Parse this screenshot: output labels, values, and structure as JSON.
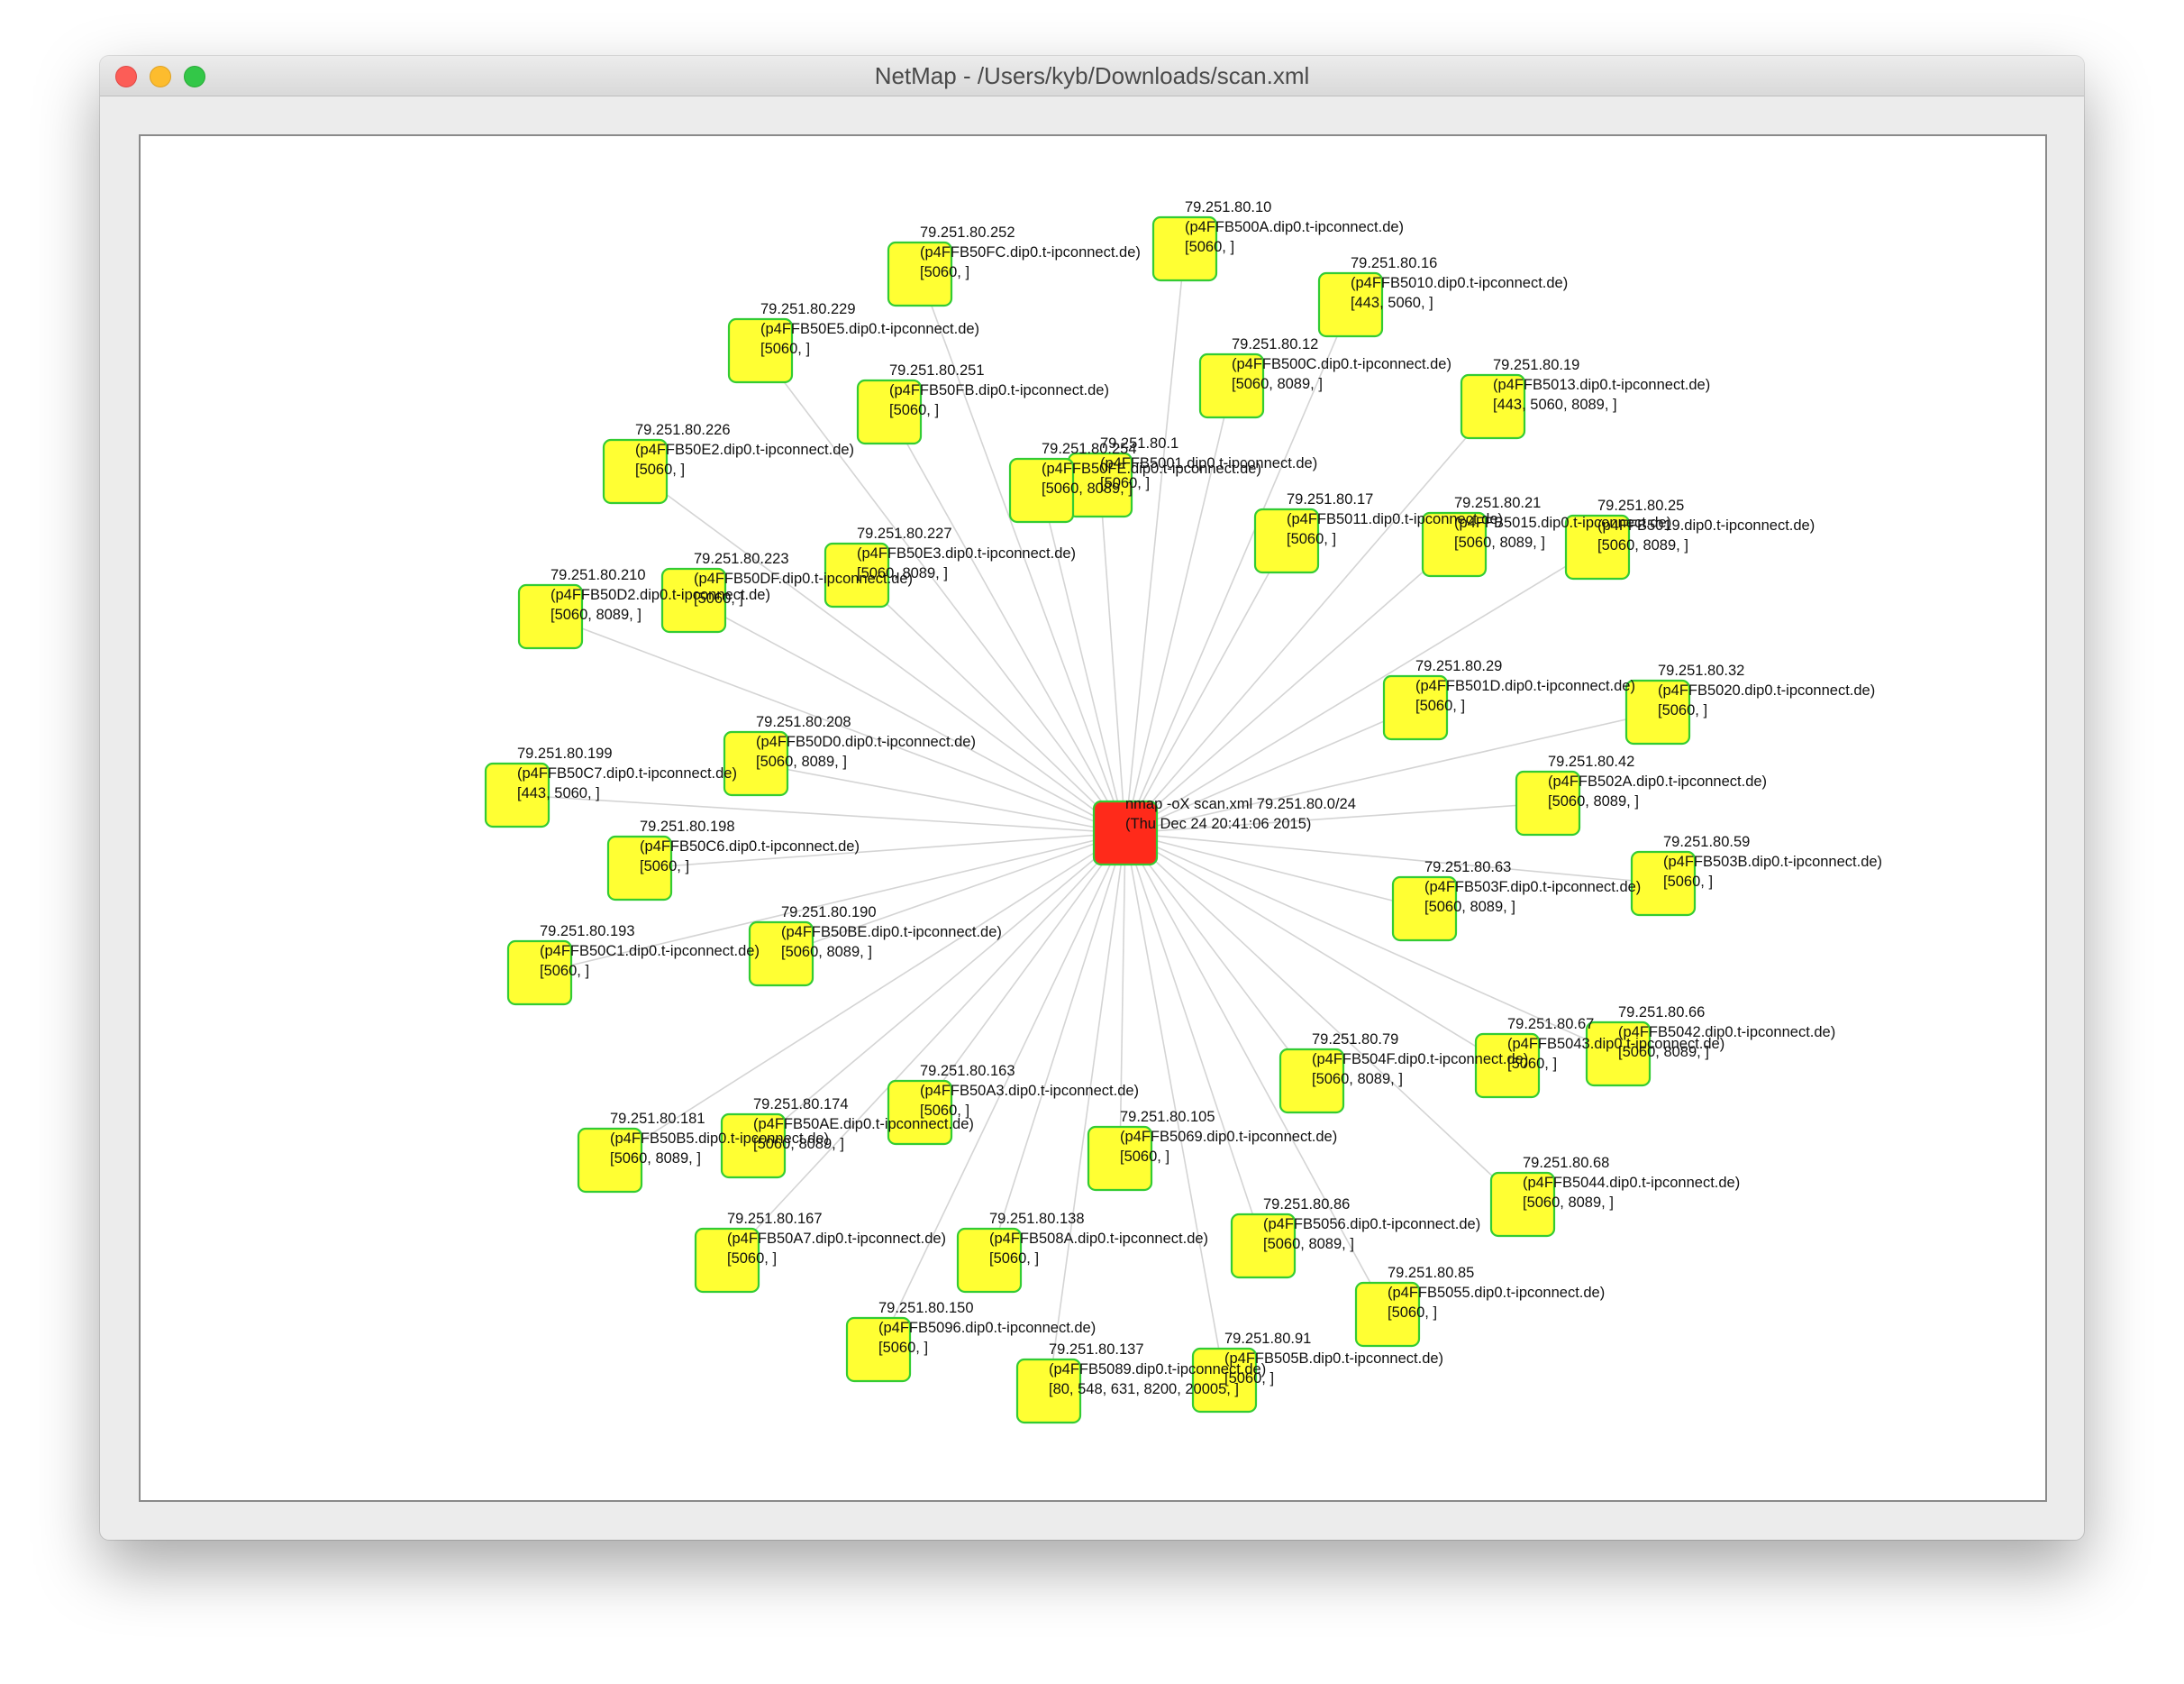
{
  "window": {
    "title": "NetMap - /Users/kyb/Downloads/scan.xml"
  },
  "colors": {
    "root_fill": "#ff2a1a",
    "host_fill": "#ffff33",
    "node_border": "#33cc33",
    "edge": "#d4d4d4"
  },
  "root": {
    "line1": "nmap -oX scan.xml 79.251.80.0/24",
    "line2": "(Thu Dec 24 20:41:06 2015)"
  },
  "hosts": [
    {
      "ip": "79.251.80.10",
      "host": "(p4FFB500A.dip0.t-ipconnect.de)",
      "ports": "[5060, ]"
    },
    {
      "ip": "79.251.80.252",
      "host": "(p4FFB50FC.dip0.t-ipconnect.de)",
      "ports": "[5060, ]"
    },
    {
      "ip": "79.251.80.16",
      "host": "(p4FFB5010.dip0.t-ipconnect.de)",
      "ports": "[443, 5060, ]"
    },
    {
      "ip": "79.251.80.229",
      "host": "(p4FFB50E5.dip0.t-ipconnect.de)",
      "ports": "[5060, ]"
    },
    {
      "ip": "79.251.80.12",
      "host": "(p4FFB500C.dip0.t-ipconnect.de)",
      "ports": "[5060, 8089, ]"
    },
    {
      "ip": "79.251.80.251",
      "host": "(p4FFB50FB.dip0.t-ipconnect.de)",
      "ports": "[5060, ]"
    },
    {
      "ip": "79.251.80.19",
      "host": "(p4FFB5013.dip0.t-ipconnect.de)",
      "ports": "[443, 5060, 8089, ]"
    },
    {
      "ip": "79.251.80.226",
      "host": "(p4FFB50E2.dip0.t-ipconnect.de)",
      "ports": "[5060, ]"
    },
    {
      "ip": "79.251.80.1",
      "host": "(p4FFB5001.dip0.t-ipconnect.de)",
      "ports": "[5060, ]"
    },
    {
      "ip": "79.251.80.254",
      "host": "(p4FFB50FE.dip0.t-ipconnect.de)",
      "ports": "[5060, 8089, ]"
    },
    {
      "ip": "79.251.80.17",
      "host": "(p4FFB5011.dip0.t-ipconnect.de)",
      "ports": "[5060, ]"
    },
    {
      "ip": "79.251.80.21",
      "host": "(p4FFB5015.dip0.t-ipconnect.de)",
      "ports": "[5060, 8089, ]"
    },
    {
      "ip": "79.251.80.25",
      "host": "(p4FFB5019.dip0.t-ipconnect.de)",
      "ports": "[5060, 8089, ]"
    },
    {
      "ip": "79.251.80.227",
      "host": "(p4FFB50E3.dip0.t-ipconnect.de)",
      "ports": "[5060, 8089, ]"
    },
    {
      "ip": "79.251.80.223",
      "host": "(p4FFB50DF.dip0.t-ipconnect.de)",
      "ports": "[5060, ]"
    },
    {
      "ip": "79.251.80.210",
      "host": "(p4FFB50D2.dip0.t-ipconnect.de)",
      "ports": "[5060, 8089, ]"
    },
    {
      "ip": "79.251.80.29",
      "host": "(p4FFB501D.dip0.t-ipconnect.de)",
      "ports": "[5060, ]"
    },
    {
      "ip": "79.251.80.32",
      "host": "(p4FFB5020.dip0.t-ipconnect.de)",
      "ports": "[5060, ]"
    },
    {
      "ip": "79.251.80.208",
      "host": "(p4FFB50D0.dip0.t-ipconnect.de)",
      "ports": "[5060, 8089, ]"
    },
    {
      "ip": "79.251.80.42",
      "host": "(p4FFB502A.dip0.t-ipconnect.de)",
      "ports": "[5060, 8089, ]"
    },
    {
      "ip": "79.251.80.199",
      "host": "(p4FFB50C7.dip0.t-ipconnect.de)",
      "ports": "[443, 5060, ]"
    },
    {
      "ip": "79.251.80.198",
      "host": "(p4FFB50C6.dip0.t-ipconnect.de)",
      "ports": "[5060, ]"
    },
    {
      "ip": "79.251.80.59",
      "host": "(p4FFB503B.dip0.t-ipconnect.de)",
      "ports": "[5060, ]"
    },
    {
      "ip": "79.251.80.63",
      "host": "(p4FFB503F.dip0.t-ipconnect.de)",
      "ports": "[5060, 8089, ]"
    },
    {
      "ip": "79.251.80.190",
      "host": "(p4FFB50BE.dip0.t-ipconnect.de)",
      "ports": "[5060, 8089, ]"
    },
    {
      "ip": "79.251.80.193",
      "host": "(p4FFB50C1.dip0.t-ipconnect.de)",
      "ports": "[5060, ]"
    },
    {
      "ip": "79.251.80.66",
      "host": "(p4FFB5042.dip0.t-ipconnect.de)",
      "ports": "[5060, 8089, ]"
    },
    {
      "ip": "79.251.80.67",
      "host": "(p4FFB5043.dip0.t-ipconnect.de)",
      "ports": "[5060, ]"
    },
    {
      "ip": "79.251.80.79",
      "host": "(p4FFB504F.dip0.t-ipconnect.de)",
      "ports": "[5060, 8089, ]"
    },
    {
      "ip": "79.251.80.163",
      "host": "(p4FFB50A3.dip0.t-ipconnect.de)",
      "ports": "[5060, ]"
    },
    {
      "ip": "79.251.80.174",
      "host": "(p4FFB50AE.dip0.t-ipconnect.de)",
      "ports": "[5060, 8089, ]"
    },
    {
      "ip": "79.251.80.181",
      "host": "(p4FFB50B5.dip0.t-ipconnect.de)",
      "ports": "[5060, 8089, ]"
    },
    {
      "ip": "79.251.80.105",
      "host": "(p4FFB5069.dip0.t-ipconnect.de)",
      "ports": "[5060, ]"
    },
    {
      "ip": "79.251.80.68",
      "host": "(p4FFB5044.dip0.t-ipconnect.de)",
      "ports": "[5060, 8089, ]"
    },
    {
      "ip": "79.251.80.86",
      "host": "(p4FFB5056.dip0.t-ipconnect.de)",
      "ports": "[5060, 8089, ]"
    },
    {
      "ip": "79.251.80.167",
      "host": "(p4FFB50A7.dip0.t-ipconnect.de)",
      "ports": "[5060, ]"
    },
    {
      "ip": "79.251.80.138",
      "host": "(p4FFB508A.dip0.t-ipconnect.de)",
      "ports": "[5060, ]"
    },
    {
      "ip": "79.251.80.85",
      "host": "(p4FFB5055.dip0.t-ipconnect.de)",
      "ports": "[5060, ]"
    },
    {
      "ip": "79.251.80.150",
      "host": "(p4FFB5096.dip0.t-ipconnect.de)",
      "ports": "[5060, ]"
    },
    {
      "ip": "79.251.80.137",
      "host": "(p4FFB5089.dip0.t-ipconnect.de)",
      "ports": "[80, 548, 631, 8200, 20005, ]"
    },
    {
      "ip": "79.251.80.91",
      "host": "(p4FFB505B.dip0.t-ipconnect.de)",
      "ports": "[5060, ]"
    }
  ]
}
